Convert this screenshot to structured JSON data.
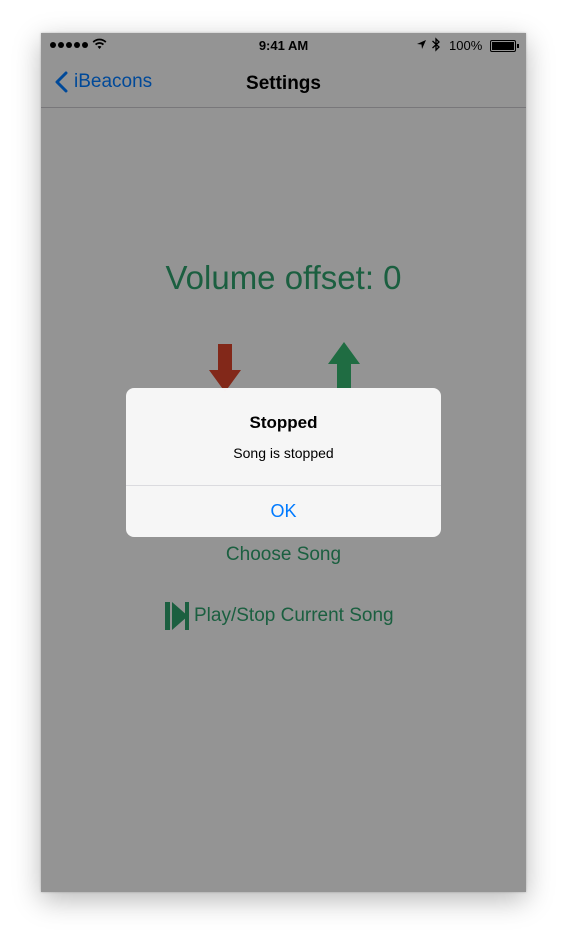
{
  "status_bar": {
    "time": "9:41 AM",
    "battery_percent": "100%",
    "icons": [
      "signal-dots-icon",
      "wifi-icon",
      "location-arrow-icon",
      "bluetooth-icon",
      "battery-icon"
    ]
  },
  "nav": {
    "back_label": "iBeacons",
    "title": "Settings"
  },
  "main": {
    "volume_label": "Volume offset: 0",
    "volume_down_icon": "red-down-arrow-icon",
    "volume_up_icon": "green-up-arrow-icon",
    "choose_song": "Choose Song",
    "play_stop": "Play/Stop Current Song"
  },
  "alert": {
    "title": "Stopped",
    "message": "Song is stopped",
    "ok_label": "OK"
  },
  "colors": {
    "accent": "#007aff",
    "green": "#2d9f6b",
    "red": "#d9442a",
    "dim_overlay": "rgba(0,0,0,0.4)"
  }
}
